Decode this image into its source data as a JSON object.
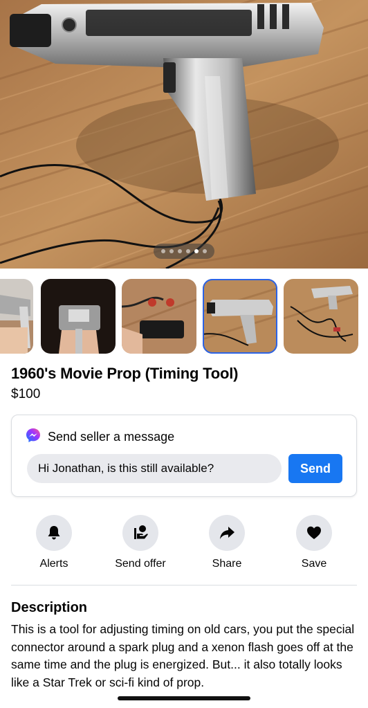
{
  "hero": {
    "image_description_icon": "photo-timing-light",
    "pager": {
      "count": 6,
      "active_index": 4
    }
  },
  "thumbnails": [
    {
      "name": "thumb-1",
      "selected": false
    },
    {
      "name": "thumb-2",
      "selected": false
    },
    {
      "name": "thumb-3",
      "selected": false
    },
    {
      "name": "thumb-4",
      "selected": true
    },
    {
      "name": "thumb-5",
      "selected": false
    }
  ],
  "listing": {
    "title": "1960's Movie Prop (Timing Tool)",
    "price": "$100"
  },
  "message_card": {
    "heading": "Send seller a message",
    "icon": "messenger-icon",
    "input_value": "Hi Jonathan, is this still available?",
    "send_label": "Send"
  },
  "actions": [
    {
      "label": "Alerts",
      "icon": "bell-icon"
    },
    {
      "label": "Send offer",
      "icon": "offer-icon"
    },
    {
      "label": "Share",
      "icon": "share-icon"
    },
    {
      "label": "Save",
      "icon": "heart-icon"
    }
  ],
  "description": {
    "heading": "Description",
    "body": "This is a tool for adjusting timing on old cars, you put the special connector around a spark plug and a xenon flash goes off at the same time and the plug is energized. But... it also totally looks like a Star Trek or sci-fi kind of prop."
  },
  "colors": {
    "accent": "#1877f2",
    "selected_outline": "#2b63e6",
    "chip_bg": "#e4e6eb"
  }
}
